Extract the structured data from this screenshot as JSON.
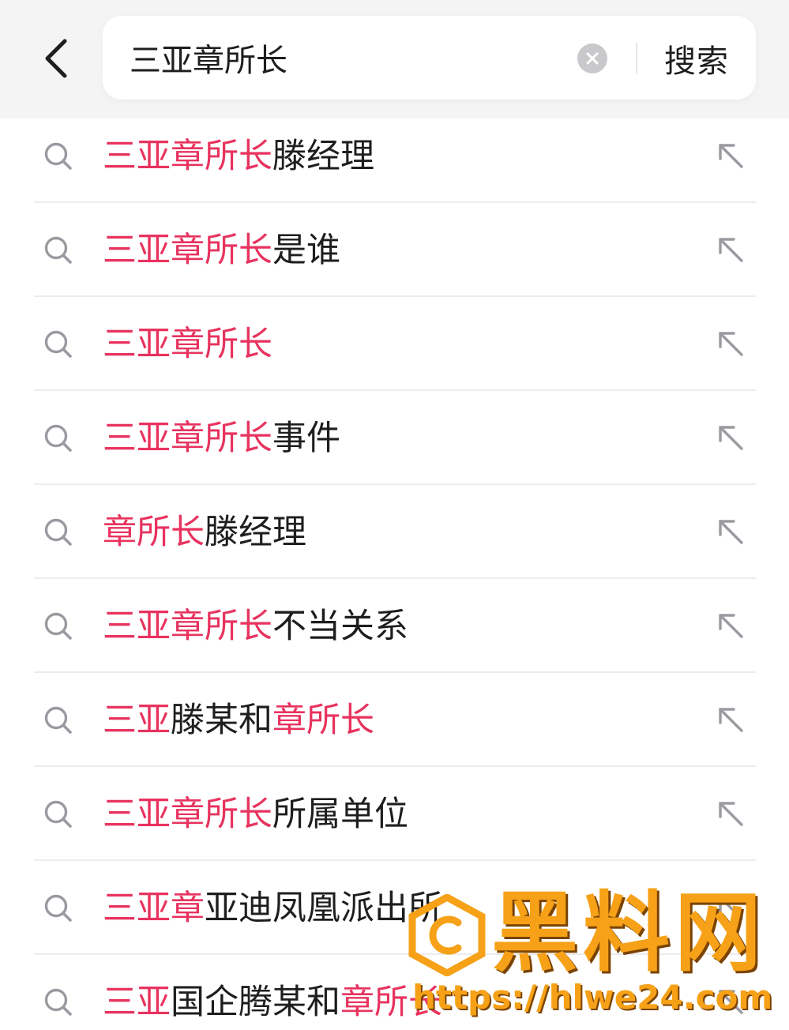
{
  "header": {
    "back_icon": "chevron-left-icon",
    "search_query": "三亚章所长",
    "clear_icon": "clear-circle-icon",
    "search_button_label": "搜索"
  },
  "suggestions": [
    {
      "parts": [
        {
          "text": "三亚章所长",
          "highlight": true
        },
        {
          "text": "滕经理",
          "highlight": false
        }
      ]
    },
    {
      "parts": [
        {
          "text": "三亚章所长",
          "highlight": true
        },
        {
          "text": "是谁",
          "highlight": false
        }
      ]
    },
    {
      "parts": [
        {
          "text": "三亚章所长",
          "highlight": true
        }
      ]
    },
    {
      "parts": [
        {
          "text": "三亚章所长",
          "highlight": true
        },
        {
          "text": "事件",
          "highlight": false
        }
      ]
    },
    {
      "parts": [
        {
          "text": "章所长",
          "highlight": true
        },
        {
          "text": "滕经理",
          "highlight": false
        }
      ]
    },
    {
      "parts": [
        {
          "text": "三亚章所长",
          "highlight": true
        },
        {
          "text": "不当关系",
          "highlight": false
        }
      ]
    },
    {
      "parts": [
        {
          "text": "三亚",
          "highlight": true
        },
        {
          "text": "滕某和",
          "highlight": false
        },
        {
          "text": "章所长",
          "highlight": true
        }
      ]
    },
    {
      "parts": [
        {
          "text": "三亚章所长",
          "highlight": true
        },
        {
          "text": "所属单位",
          "highlight": false
        }
      ]
    },
    {
      "parts": [
        {
          "text": "三亚章",
          "highlight": true
        },
        {
          "text": "亚迪凤凰派出所",
          "highlight": false
        }
      ]
    },
    {
      "parts": [
        {
          "text": "三亚",
          "highlight": true
        },
        {
          "text": "国企腾某和",
          "highlight": false
        },
        {
          "text": "章所长",
          "highlight": true
        }
      ]
    }
  ],
  "row_icons": {
    "search": "search-icon",
    "fill": "arrow-up-left-icon"
  },
  "watermark": {
    "title": "黑料网",
    "url": "https://hlwe24.com"
  },
  "colors": {
    "highlight": "#e8335f",
    "text": "#1e1e1e",
    "header_bg": "#f4f4f5",
    "icon_gray": "#9a9aa0",
    "watermark": "#f6a117"
  }
}
